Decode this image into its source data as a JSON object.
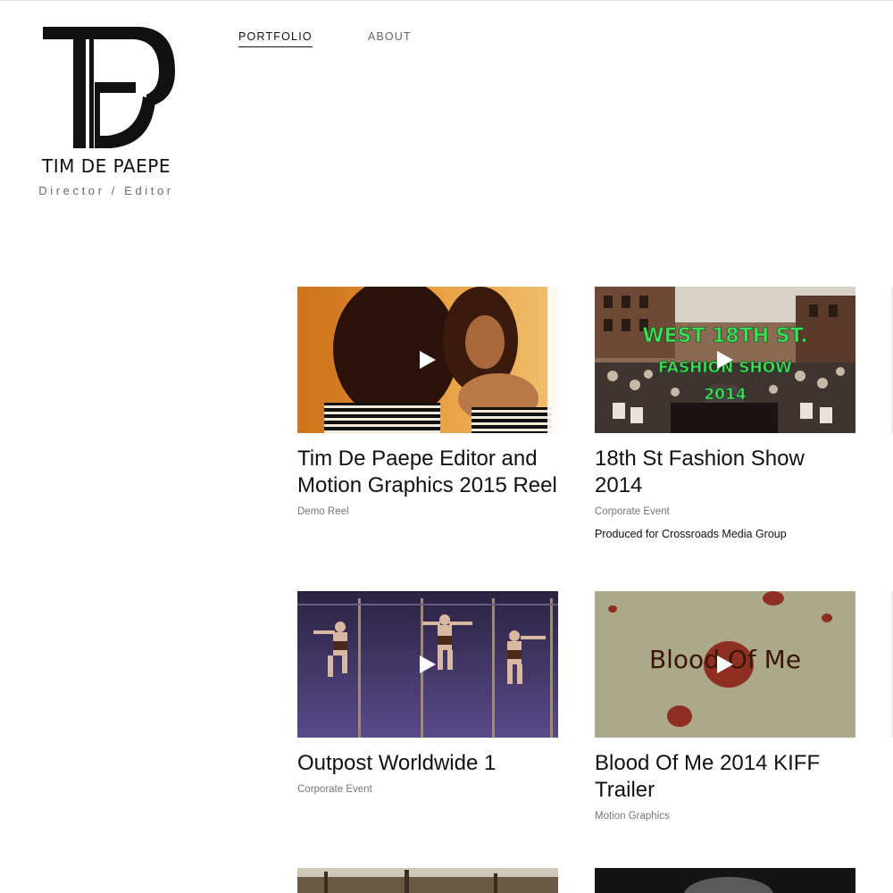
{
  "brand": {
    "name": "TIM DE PAEPE",
    "tagline": "Director / Editor"
  },
  "nav": {
    "items": [
      {
        "label": "PORTFOLIO",
        "active": true
      },
      {
        "label": "ABOUT",
        "active": false
      }
    ]
  },
  "portfolio": {
    "items": [
      {
        "title": "Tim De Paepe Editor and Motion Graphics 2015 Reel",
        "category": "Demo Reel",
        "description": ""
      },
      {
        "title": "18th St Fashion Show 2014",
        "category": "Corporate Event",
        "description": "Produced for Crossroads Media Group",
        "thumb_text": [
          "WEST 18TH ST.",
          "FASHION SHOW",
          "2014"
        ]
      },
      {
        "title": "Outpost Worldwide 1",
        "category": "Corporate Event",
        "description": ""
      },
      {
        "title": "Blood Of Me 2014 KIFF Trailer",
        "category": "Motion Graphics",
        "description": "",
        "thumb_text": [
          "Blood Of Me"
        ]
      }
    ]
  },
  "colors": {
    "accent_green": "#3ddc5a",
    "text": "#111111",
    "muted": "#777777"
  }
}
